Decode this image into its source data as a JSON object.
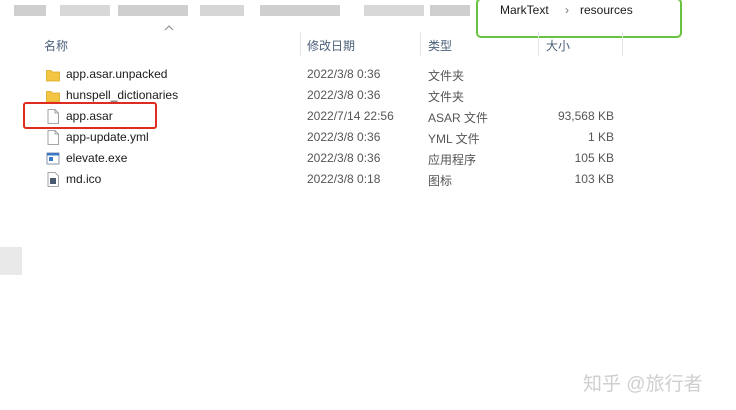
{
  "breadcrumb": {
    "items": [
      "MarkText",
      "resources"
    ],
    "separator": "›"
  },
  "columns": {
    "name": "名称",
    "date": "修改日期",
    "type": "类型",
    "size": "大小"
  },
  "files": [
    {
      "name": "app.asar.unpacked",
      "date": "2022/3/8 0:36",
      "type": "文件夹",
      "size": "",
      "icon": "folder-icon"
    },
    {
      "name": "hunspell_dictionaries",
      "date": "2022/3/8 0:36",
      "type": "文件夹",
      "size": "",
      "icon": "folder-icon"
    },
    {
      "name": "app.asar",
      "date": "2022/7/14 22:56",
      "type": "ASAR 文件",
      "size": "93,568 KB",
      "icon": "file-icon"
    },
    {
      "name": "app-update.yml",
      "date": "2022/3/8 0:36",
      "type": "YML 文件",
      "size": "1 KB",
      "icon": "file-icon"
    },
    {
      "name": "elevate.exe",
      "date": "2022/3/8 0:36",
      "type": "应用程序",
      "size": "105 KB",
      "icon": "exe-icon"
    },
    {
      "name": "md.ico",
      "date": "2022/3/8 0:18",
      "type": "图标",
      "size": "103 KB",
      "icon": "ico-icon"
    }
  ],
  "watermark": "知乎 @旅行者",
  "colors": {
    "highlight_red": "#e02b20",
    "highlight_green": "#6ac33f",
    "folder": "#f4c542",
    "header_text": "#4c607a"
  }
}
